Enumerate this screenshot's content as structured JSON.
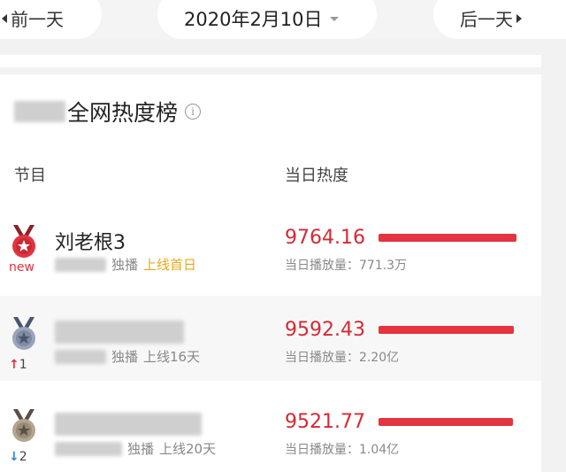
{
  "nav": {
    "prev_label": "前一天",
    "date_label": "2020年2月10日",
    "next_label": "后一天"
  },
  "board": {
    "title": "全网热度榜",
    "info_icon": "i",
    "col_program": "节目",
    "col_heat": "当日热度"
  },
  "rows": [
    {
      "rank_change": "new",
      "medal": "gold-medal",
      "name": "刘老根3",
      "exclusive": "独播",
      "online": "上线首日",
      "heat": "9764.16",
      "heat_fraction": 1.0,
      "plays": "当日播放量：771.3万"
    },
    {
      "rank_change": "1",
      "rank_dir": "up",
      "medal": "silver-medal",
      "name": "",
      "exclusive": "独播",
      "online": "上线16天",
      "heat": "9592.43",
      "heat_fraction": 0.982,
      "plays": "当日播放量：2.20亿"
    },
    {
      "rank_change": "2",
      "rank_dir": "down",
      "medal": "bronze-medal",
      "name": "",
      "exclusive": "独播",
      "online": "上线20天",
      "heat": "9521.77",
      "heat_fraction": 0.975,
      "plays": "当日播放量：1.04亿"
    }
  ],
  "colors": {
    "accent_red": "#e3343f",
    "heat_text": "#d42a36",
    "first_day": "#e8a91a",
    "up_arrow": "#e0333f",
    "down_arrow": "#2f86d6"
  }
}
